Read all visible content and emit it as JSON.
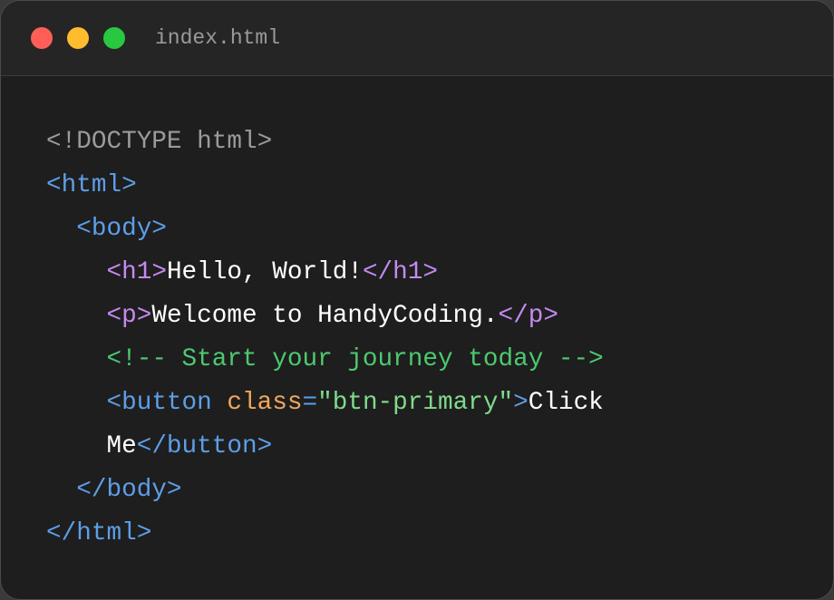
{
  "window": {
    "controls": {
      "close_color": "#ff5f57",
      "minimize_color": "#febc2e",
      "maximize_color": "#28c840"
    },
    "filename": "index.html"
  },
  "code": {
    "lines": [
      {
        "indent": "",
        "tokens": [
          {
            "type": "doctype",
            "text": "<!DOCTYPE html>"
          }
        ]
      },
      {
        "indent": "",
        "tokens": [
          {
            "type": "html-tag",
            "text": "<html>"
          }
        ]
      },
      {
        "indent": "  ",
        "tokens": [
          {
            "type": "html-tag",
            "text": "<body>"
          }
        ]
      },
      {
        "indent": "    ",
        "tokens": [
          {
            "type": "h-tag",
            "text": "<h1>"
          },
          {
            "type": "text",
            "text": "Hello, World!"
          },
          {
            "type": "h-tag",
            "text": "</h1>"
          }
        ]
      },
      {
        "indent": "    ",
        "tokens": [
          {
            "type": "h-tag",
            "text": "<p>"
          },
          {
            "type": "text",
            "text": "Welcome to HandyCoding."
          },
          {
            "type": "h-tag",
            "text": "</p>"
          }
        ]
      },
      {
        "indent": "    ",
        "tokens": [
          {
            "type": "comment",
            "text": "<!-- Start your journey today -->"
          }
        ]
      },
      {
        "indent": "    ",
        "tokens": [
          {
            "type": "html-tag",
            "text": "<button "
          },
          {
            "type": "attr",
            "text": "class"
          },
          {
            "type": "html-tag",
            "text": "="
          },
          {
            "type": "string",
            "text": "\"btn-primary\""
          },
          {
            "type": "html-tag",
            "text": ">"
          },
          {
            "type": "text",
            "text": "Click"
          }
        ]
      },
      {
        "indent": "    ",
        "tokens": [
          {
            "type": "text",
            "text": "Me"
          },
          {
            "type": "html-tag",
            "text": "</button>"
          }
        ]
      },
      {
        "indent": "  ",
        "tokens": [
          {
            "type": "html-tag",
            "text": "</body>"
          }
        ]
      },
      {
        "indent": "",
        "tokens": [
          {
            "type": "html-tag",
            "text": "</html>"
          }
        ]
      }
    ]
  }
}
